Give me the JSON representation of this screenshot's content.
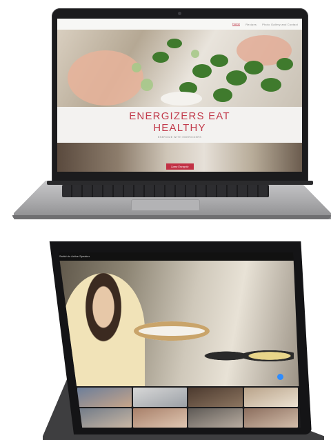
{
  "laptop": {
    "website": {
      "nav": [
        "Home",
        "Recipes",
        "Photo Gallery and Contact"
      ],
      "title_line1": "ENERGIZERS EAT",
      "title_line2": "HEALTHY",
      "subtitle": "ENERGIZE WITH ENERGIZERS",
      "signature": "Lama Energetic"
    }
  },
  "tablet": {
    "zoom": {
      "top_button": "Switch to Active Speaker",
      "participant_tiles": 8
    }
  },
  "colors": {
    "brand_red": "#c23b4c",
    "zoom_blue": "#2d8cff"
  }
}
